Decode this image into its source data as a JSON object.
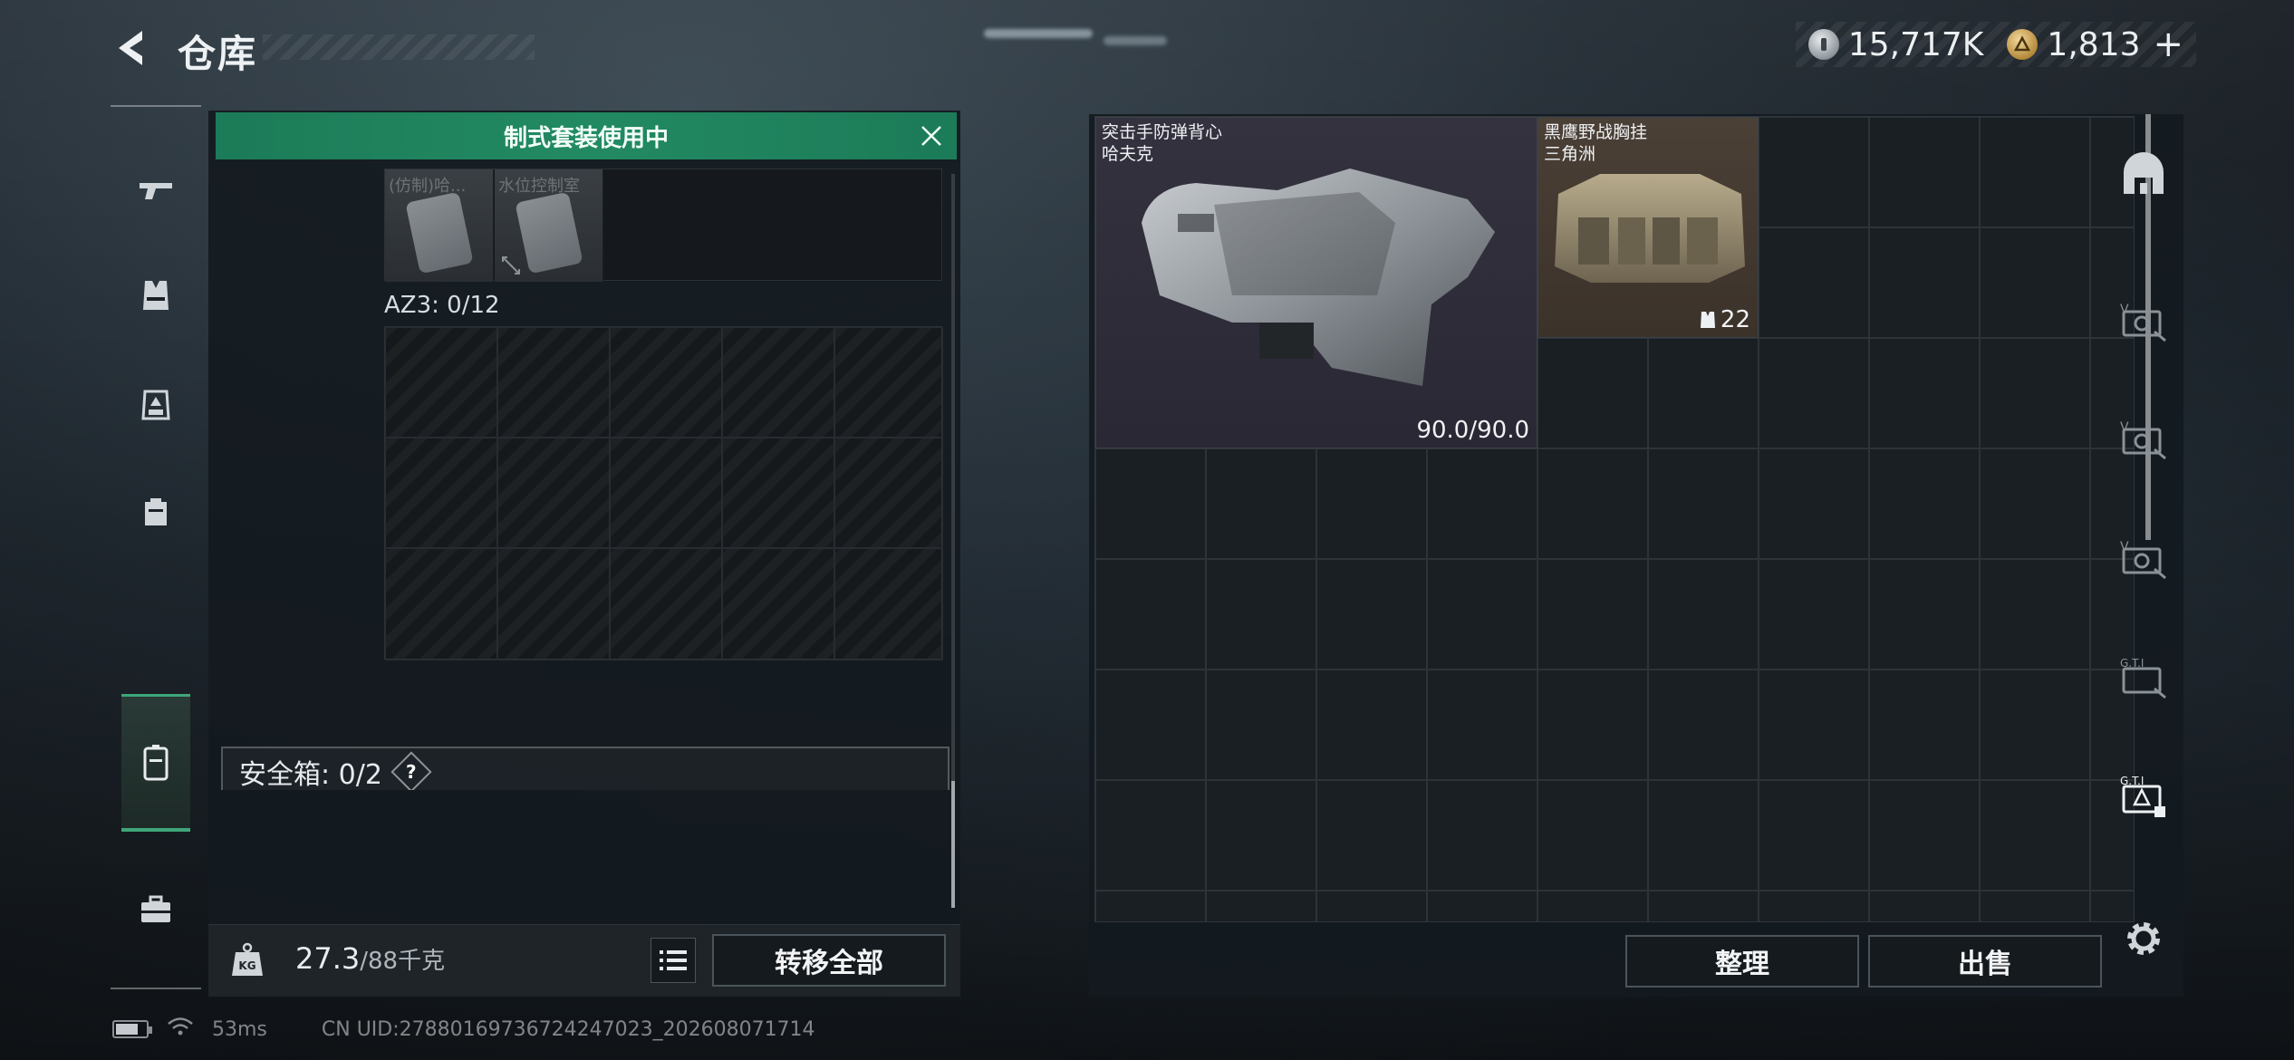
{
  "header": {
    "title": "仓库",
    "currency": [
      {
        "name": "hafu-coin",
        "value": "15,717K"
      },
      {
        "name": "triangle-coin",
        "value": "1,813"
      }
    ],
    "add_label": "+"
  },
  "left_rail": {
    "items": [
      "gun-icon",
      "vest-icon",
      "rig-icon",
      "backpack-icon",
      "safe-case-icon",
      "briefcase-icon"
    ],
    "active_index": 4
  },
  "loadout": {
    "notice": "制式套装使用中",
    "top_slots": [
      {
        "label": "(仿制)哈..."
      },
      {
        "label": "水位控制室"
      }
    ],
    "rig_label": "AZ3: 0/12",
    "safe_label": "安全箱: 0/2",
    "help_label": "?",
    "weight_current": "27.3",
    "weight_total": "/88千克",
    "transfer_all": "转移全部"
  },
  "status": {
    "ping": "53ms",
    "uid": "CN UID:2788016973672424702​3_202608071714"
  },
  "stash": {
    "items": [
      {
        "name_line1": "突击手防弹背心",
        "name_line2": "哈夫克",
        "durability": "90.0/90.0"
      },
      {
        "name_line1": "黑鹰野战胸挂",
        "name_line2": "三角洲",
        "capacity": "22"
      }
    ],
    "sort_label": "整理",
    "sell_label": "出售"
  },
  "right_rail": {
    "items": [
      "storage-icon",
      "v-stash-1-icon",
      "v-stash-2-icon",
      "v-stash-3-icon",
      "gti-stash-icon",
      "gti-stash-selected-icon",
      "settings-icon"
    ]
  },
  "colors": {
    "accent_green": "#1c7b58",
    "panel_bg": "#141a1f",
    "vest_bg": "#34323f",
    "rig_bg": "#4b4036"
  }
}
